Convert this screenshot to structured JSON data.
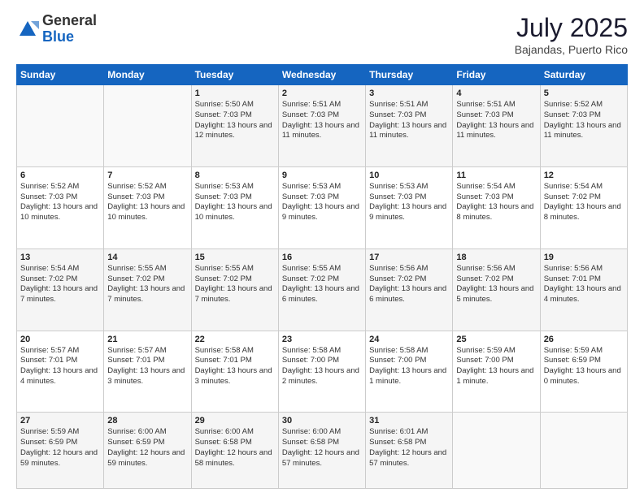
{
  "header": {
    "logo_general": "General",
    "logo_blue": "Blue",
    "month": "July 2025",
    "location": "Bajandas, Puerto Rico"
  },
  "days_of_week": [
    "Sunday",
    "Monday",
    "Tuesday",
    "Wednesday",
    "Thursday",
    "Friday",
    "Saturday"
  ],
  "weeks": [
    [
      {
        "day": "",
        "info": ""
      },
      {
        "day": "",
        "info": ""
      },
      {
        "day": "1",
        "info": "Sunrise: 5:50 AM\nSunset: 7:03 PM\nDaylight: 13 hours and 12 minutes."
      },
      {
        "day": "2",
        "info": "Sunrise: 5:51 AM\nSunset: 7:03 PM\nDaylight: 13 hours and 11 minutes."
      },
      {
        "day": "3",
        "info": "Sunrise: 5:51 AM\nSunset: 7:03 PM\nDaylight: 13 hours and 11 minutes."
      },
      {
        "day": "4",
        "info": "Sunrise: 5:51 AM\nSunset: 7:03 PM\nDaylight: 13 hours and 11 minutes."
      },
      {
        "day": "5",
        "info": "Sunrise: 5:52 AM\nSunset: 7:03 PM\nDaylight: 13 hours and 11 minutes."
      }
    ],
    [
      {
        "day": "6",
        "info": "Sunrise: 5:52 AM\nSunset: 7:03 PM\nDaylight: 13 hours and 10 minutes."
      },
      {
        "day": "7",
        "info": "Sunrise: 5:52 AM\nSunset: 7:03 PM\nDaylight: 13 hours and 10 minutes."
      },
      {
        "day": "8",
        "info": "Sunrise: 5:53 AM\nSunset: 7:03 PM\nDaylight: 13 hours and 10 minutes."
      },
      {
        "day": "9",
        "info": "Sunrise: 5:53 AM\nSunset: 7:03 PM\nDaylight: 13 hours and 9 minutes."
      },
      {
        "day": "10",
        "info": "Sunrise: 5:53 AM\nSunset: 7:03 PM\nDaylight: 13 hours and 9 minutes."
      },
      {
        "day": "11",
        "info": "Sunrise: 5:54 AM\nSunset: 7:03 PM\nDaylight: 13 hours and 8 minutes."
      },
      {
        "day": "12",
        "info": "Sunrise: 5:54 AM\nSunset: 7:02 PM\nDaylight: 13 hours and 8 minutes."
      }
    ],
    [
      {
        "day": "13",
        "info": "Sunrise: 5:54 AM\nSunset: 7:02 PM\nDaylight: 13 hours and 7 minutes."
      },
      {
        "day": "14",
        "info": "Sunrise: 5:55 AM\nSunset: 7:02 PM\nDaylight: 13 hours and 7 minutes."
      },
      {
        "day": "15",
        "info": "Sunrise: 5:55 AM\nSunset: 7:02 PM\nDaylight: 13 hours and 7 minutes."
      },
      {
        "day": "16",
        "info": "Sunrise: 5:55 AM\nSunset: 7:02 PM\nDaylight: 13 hours and 6 minutes."
      },
      {
        "day": "17",
        "info": "Sunrise: 5:56 AM\nSunset: 7:02 PM\nDaylight: 13 hours and 6 minutes."
      },
      {
        "day": "18",
        "info": "Sunrise: 5:56 AM\nSunset: 7:02 PM\nDaylight: 13 hours and 5 minutes."
      },
      {
        "day": "19",
        "info": "Sunrise: 5:56 AM\nSunset: 7:01 PM\nDaylight: 13 hours and 4 minutes."
      }
    ],
    [
      {
        "day": "20",
        "info": "Sunrise: 5:57 AM\nSunset: 7:01 PM\nDaylight: 13 hours and 4 minutes."
      },
      {
        "day": "21",
        "info": "Sunrise: 5:57 AM\nSunset: 7:01 PM\nDaylight: 13 hours and 3 minutes."
      },
      {
        "day": "22",
        "info": "Sunrise: 5:58 AM\nSunset: 7:01 PM\nDaylight: 13 hours and 3 minutes."
      },
      {
        "day": "23",
        "info": "Sunrise: 5:58 AM\nSunset: 7:00 PM\nDaylight: 13 hours and 2 minutes."
      },
      {
        "day": "24",
        "info": "Sunrise: 5:58 AM\nSunset: 7:00 PM\nDaylight: 13 hours and 1 minute."
      },
      {
        "day": "25",
        "info": "Sunrise: 5:59 AM\nSunset: 7:00 PM\nDaylight: 13 hours and 1 minute."
      },
      {
        "day": "26",
        "info": "Sunrise: 5:59 AM\nSunset: 6:59 PM\nDaylight: 13 hours and 0 minutes."
      }
    ],
    [
      {
        "day": "27",
        "info": "Sunrise: 5:59 AM\nSunset: 6:59 PM\nDaylight: 12 hours and 59 minutes."
      },
      {
        "day": "28",
        "info": "Sunrise: 6:00 AM\nSunset: 6:59 PM\nDaylight: 12 hours and 59 minutes."
      },
      {
        "day": "29",
        "info": "Sunrise: 6:00 AM\nSunset: 6:58 PM\nDaylight: 12 hours and 58 minutes."
      },
      {
        "day": "30",
        "info": "Sunrise: 6:00 AM\nSunset: 6:58 PM\nDaylight: 12 hours and 57 minutes."
      },
      {
        "day": "31",
        "info": "Sunrise: 6:01 AM\nSunset: 6:58 PM\nDaylight: 12 hours and 57 minutes."
      },
      {
        "day": "",
        "info": ""
      },
      {
        "day": "",
        "info": ""
      }
    ]
  ]
}
